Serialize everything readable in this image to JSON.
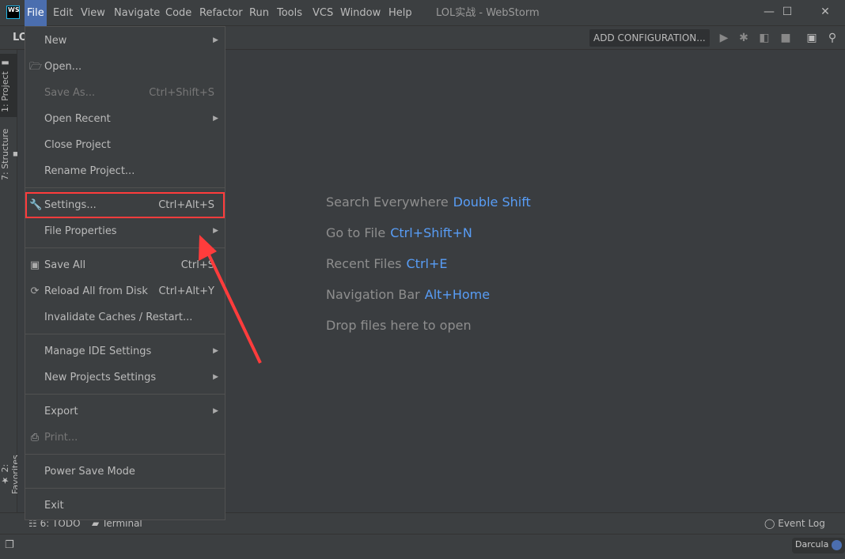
{
  "window": {
    "title": "LOL实战 - WebStorm",
    "logo": "WS",
    "minimize": "—",
    "maximize": "☐",
    "close": "✕"
  },
  "menubar": [
    {
      "label": "File",
      "active": true
    },
    {
      "label": "Edit"
    },
    {
      "label": "View"
    },
    {
      "label": "Navigate"
    },
    {
      "label": "Code"
    },
    {
      "label": "Refactor"
    },
    {
      "label": "Run"
    },
    {
      "label": "Tools"
    },
    {
      "label": "VCS"
    },
    {
      "label": "Window"
    },
    {
      "label": "Help"
    }
  ],
  "toolbar": {
    "project_label": "LO",
    "add_configuration": "ADD CONFIGURATION...",
    "icons": [
      "run-icon",
      "debug-icon",
      "coverage-icon",
      "stop-icon",
      "terminal-window-icon",
      "search-icon"
    ]
  },
  "left_tabs": {
    "project": "1: Project",
    "structure": "7: Structure",
    "favorites": "2: Favorites"
  },
  "file_menu": [
    {
      "label": "New",
      "submenu": true
    },
    {
      "label": "Open...",
      "icon": "folder-icon"
    },
    {
      "label": "Save As...",
      "shortcut": "Ctrl+Shift+S",
      "disabled": true
    },
    {
      "label": "Open Recent",
      "submenu": true
    },
    {
      "label": "Close Project"
    },
    {
      "label": "Rename Project..."
    },
    {
      "separator": true
    },
    {
      "label": "Settings...",
      "shortcut": "Ctrl+Alt+S",
      "icon": "wrench-icon",
      "highlighted": true
    },
    {
      "label": "File Properties",
      "submenu": true
    },
    {
      "separator": true
    },
    {
      "label": "Save All",
      "shortcut": "Ctrl+S",
      "icon": "save-icon"
    },
    {
      "label": "Reload All from Disk",
      "shortcut": "Ctrl+Alt+Y",
      "icon": "reload-icon"
    },
    {
      "label": "Invalidate Caches / Restart..."
    },
    {
      "separator": true
    },
    {
      "label": "Manage IDE Settings",
      "submenu": true
    },
    {
      "label": "New Projects Settings",
      "submenu": true
    },
    {
      "separator": true
    },
    {
      "label": "Export",
      "submenu": true
    },
    {
      "label": "Print...",
      "icon": "print-icon",
      "disabled": true
    },
    {
      "separator": true
    },
    {
      "label": "Power Save Mode"
    },
    {
      "separator": true
    },
    {
      "label": "Exit"
    }
  ],
  "hints": [
    {
      "text": "Search Everywhere",
      "key": "Double Shift"
    },
    {
      "text": "Go to File",
      "key": "Ctrl+Shift+N"
    },
    {
      "text": "Recent Files",
      "key": "Ctrl+E"
    },
    {
      "text": "Navigation Bar",
      "key": "Alt+Home"
    },
    {
      "text": "Drop files here to open",
      "key": ""
    }
  ],
  "bottom": {
    "todo": "6: TODO",
    "terminal": "Terminal",
    "event_log": "Event Log"
  },
  "status": {
    "theme": "Darcula"
  },
  "colors": {
    "accent": "#4b6eaf",
    "link": "#589df6",
    "highlight": "#ff3c3c"
  }
}
